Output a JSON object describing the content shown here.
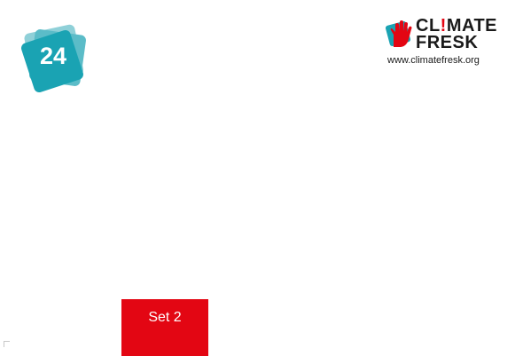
{
  "card": {
    "number": "24",
    "color": "#1aa3b3",
    "color_light": "#8fd0d8"
  },
  "logo": {
    "line1_pre": "CL",
    "line1_excl": "!",
    "line1_post": "MATE",
    "line2": "FRESK",
    "url": "www.climatefresk.org",
    "brand_color": "#e30613",
    "icon": "hand-icon"
  },
  "set": {
    "label": "Set 2",
    "color": "#e30613"
  }
}
